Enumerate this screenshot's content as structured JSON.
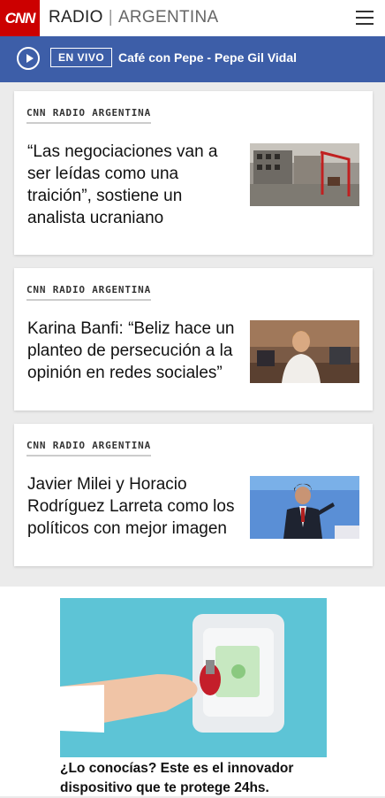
{
  "header": {
    "logo_text": "CNN",
    "brand_primary": "RADIO",
    "brand_secondary": "ARGENTINA",
    "menu_icon": "hamburger-menu-icon"
  },
  "live": {
    "badge": "EN VIVO",
    "program": "Café con Pepe - Pepe Gil Vidal",
    "play_icon": "play-icon"
  },
  "articles": [
    {
      "section": "CNN RADIO ARGENTINA",
      "title": "“Las negociaciones van a ser leídas como una traición”, sostiene un analista ucraniano"
    },
    {
      "section": "CNN RADIO ARGENTINA",
      "title": "Karina Banfi: “Beliz hace un planteo de persecución a la opinión en redes sociales”"
    },
    {
      "section": "CNN RADIO ARGENTINA",
      "title": "Javier Milei y Horacio Rodríguez Larreta como los políticos con mejor imagen"
    }
  ],
  "ad": {
    "caption": "¿Lo conocías? Este es el innovador dispositivo que te protege 24hs."
  },
  "colors": {
    "brand_red": "#cc0000",
    "live_bar": "#3d5ea8",
    "background": "#ebebeb"
  }
}
